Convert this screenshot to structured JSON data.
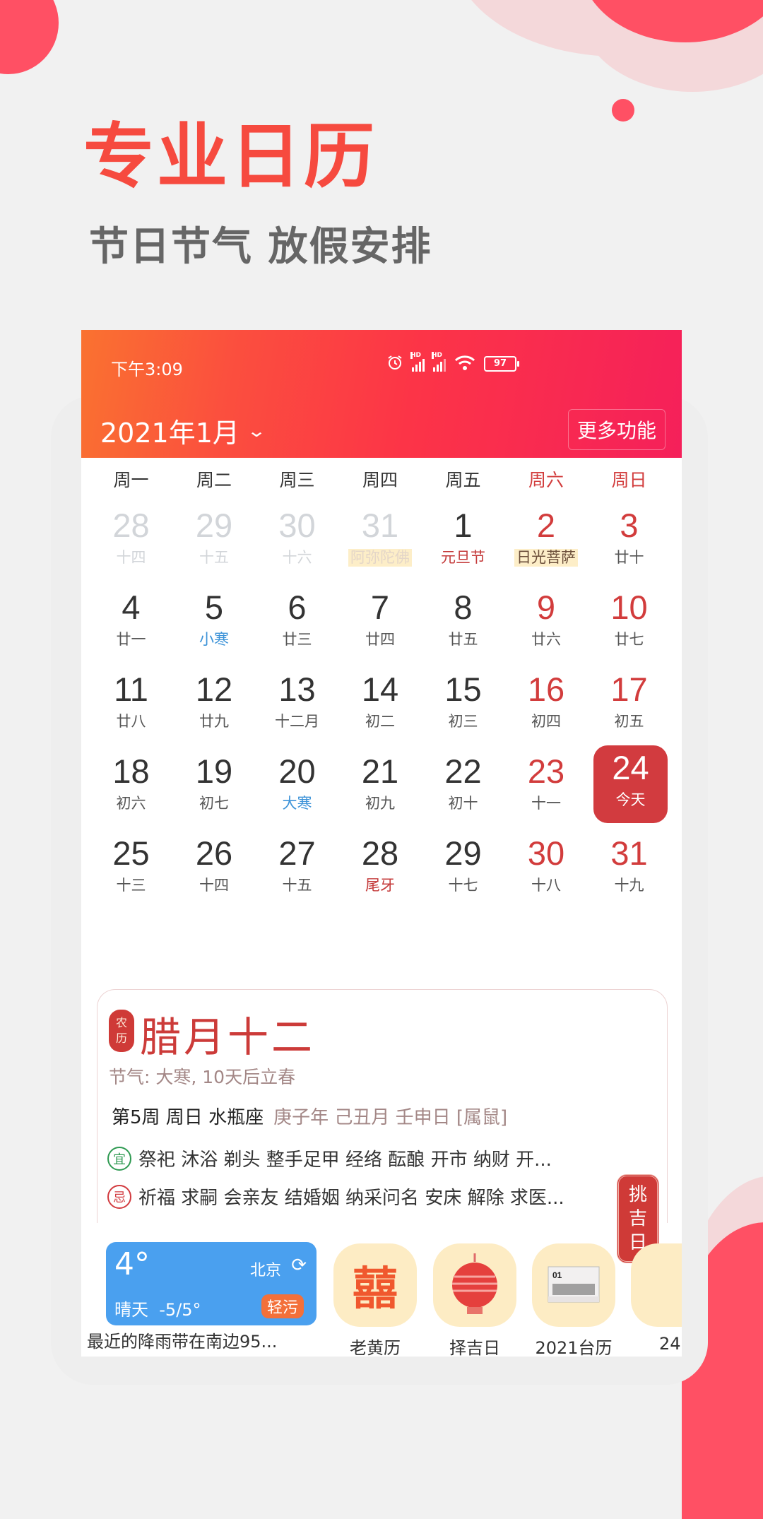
{
  "promo": {
    "title": "专业日历",
    "subtitle": "节日节气 放假安排"
  },
  "status_bar": {
    "time": "下午3:09",
    "battery": "97",
    "signal_label": "HD"
  },
  "header": {
    "month_title": "2021年1月",
    "more_button": "更多功能"
  },
  "weekdays": [
    "周一",
    "周二",
    "周三",
    "周四",
    "周五",
    "周六",
    "周日"
  ],
  "calendar": {
    "rows": [
      [
        {
          "day": "28",
          "sub": "十四",
          "type": "other"
        },
        {
          "day": "29",
          "sub": "十五",
          "type": "other"
        },
        {
          "day": "30",
          "sub": "十六",
          "type": "other"
        },
        {
          "day": "31",
          "sub": "阿弥陀佛",
          "type": "other",
          "sub_style": "hl"
        },
        {
          "day": "1",
          "sub": "元旦节",
          "sub_style": "fest"
        },
        {
          "day": "2",
          "sub": "日光菩萨",
          "type": "weekend",
          "sub_style": "hl"
        },
        {
          "day": "3",
          "sub": "廿十",
          "type": "weekend"
        }
      ],
      [
        {
          "day": "4",
          "sub": "廿一"
        },
        {
          "day": "5",
          "sub": "小寒",
          "sub_style": "term"
        },
        {
          "day": "6",
          "sub": "廿三"
        },
        {
          "day": "7",
          "sub": "廿四"
        },
        {
          "day": "8",
          "sub": "廿五"
        },
        {
          "day": "9",
          "sub": "廿六",
          "type": "weekend"
        },
        {
          "day": "10",
          "sub": "廿七",
          "type": "weekend"
        }
      ],
      [
        {
          "day": "11",
          "sub": "廿八"
        },
        {
          "day": "12",
          "sub": "廿九"
        },
        {
          "day": "13",
          "sub": "十二月"
        },
        {
          "day": "14",
          "sub": "初二"
        },
        {
          "day": "15",
          "sub": "初三"
        },
        {
          "day": "16",
          "sub": "初四",
          "type": "weekend"
        },
        {
          "day": "17",
          "sub": "初五",
          "type": "weekend"
        }
      ],
      [
        {
          "day": "18",
          "sub": "初六"
        },
        {
          "day": "19",
          "sub": "初七"
        },
        {
          "day": "20",
          "sub": "大寒",
          "sub_style": "term"
        },
        {
          "day": "21",
          "sub": "初九"
        },
        {
          "day": "22",
          "sub": "初十"
        },
        {
          "day": "23",
          "sub": "十一",
          "type": "weekend"
        },
        {
          "day": "24",
          "sub": "今天",
          "type": "today"
        }
      ],
      [
        {
          "day": "25",
          "sub": "十三"
        },
        {
          "day": "26",
          "sub": "十四"
        },
        {
          "day": "27",
          "sub": "十五"
        },
        {
          "day": "28",
          "sub": "尾牙",
          "sub_style": "fest"
        },
        {
          "day": "29",
          "sub": "十七"
        },
        {
          "day": "30",
          "sub": "十八",
          "type": "weekend"
        },
        {
          "day": "31",
          "sub": "十九",
          "type": "weekend"
        }
      ]
    ]
  },
  "detail": {
    "seal_top": "农",
    "seal_bottom": "历",
    "lunar_date": "腊月十二",
    "solar_term": "节气: 大寒, 10天后立春",
    "week_info": "第5周  周日 水瓶座",
    "ganzhi": "庚子年 己丑月 壬申日 [属鼠]",
    "good_label": "宜",
    "good_items": "祭祀 沐浴 剃头 整手足甲 经络 酝酿 开市 纳财 开...",
    "bad_label": "忌",
    "bad_items": "祈福 求嗣 会亲友 结婚姻 纳采问名 安床 解除 求医...",
    "pick_button": [
      "挑",
      "吉",
      "日"
    ]
  },
  "weather": {
    "temperature": "4°",
    "city": "北京",
    "condition": "晴天",
    "range": "-5/5°",
    "air_quality": "轻污",
    "caption": "最近的降雨带在南边95..."
  },
  "apps": [
    {
      "label": "老黄历",
      "glyph": "囍"
    },
    {
      "label": "择吉日",
      "glyph": "🏮"
    },
    {
      "label": "2021台历",
      "glyph": "📆"
    },
    {
      "label": "24",
      "glyph": ""
    }
  ],
  "colors": {
    "accent_red": "#d23b3f",
    "promo_red": "#f64a3f",
    "weather_blue": "#4aa0ef",
    "term_blue": "#3d93d8"
  }
}
